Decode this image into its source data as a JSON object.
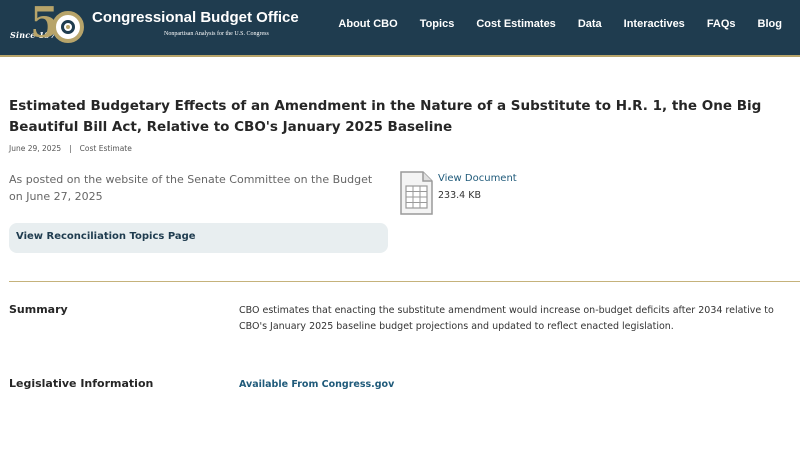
{
  "header": {
    "logo": {
      "since": "Since 1975",
      "name": "Congressional Budget Office",
      "tagline": "Nonpartisan Analysis for the U.S. Congress"
    },
    "nav": [
      "About CBO",
      "Topics",
      "Cost Estimates",
      "Data",
      "Interactives",
      "FAQs",
      "Blog"
    ]
  },
  "article": {
    "title": "Estimated Budgetary Effects of an Amendment in the Nature of a Substitute to H.R. 1, the One Big Beautiful Bill Act, Relative to CBO's January 2025 Baseline",
    "date": "June 29, 2025",
    "separator": "|",
    "type": "Cost Estimate",
    "posted_note": "As posted on the website of the Senate Committee on the Budget on June 27, 2025",
    "document": {
      "link_label": "View Document",
      "size": "233.4 KB",
      "icon": "spreadsheet-icon"
    },
    "reconciliation_link": "View Reconciliation Topics Page"
  },
  "details": {
    "summary": {
      "label": "Summary",
      "text": "CBO estimates that enacting the substitute amendment would increase on-budget deficits after 2034 relative to CBO's January 2025 baseline budget projections and updated to reflect enacted legislation."
    },
    "legislative": {
      "label": "Legislative Information",
      "link": "Available From Congress.gov"
    }
  },
  "colors": {
    "header_bg": "#1f3c4f",
    "accent_gold": "#b7a46a",
    "link": "#1f5a7a"
  }
}
